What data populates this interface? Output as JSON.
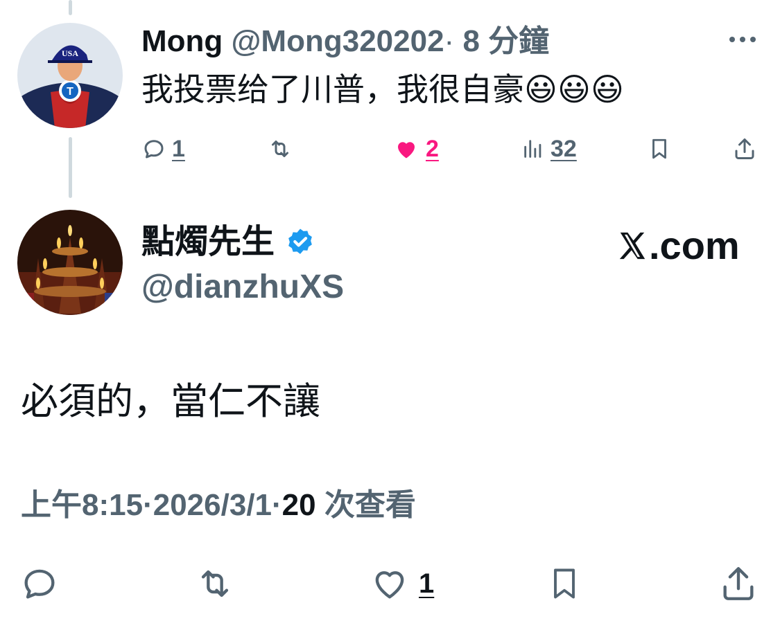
{
  "reply_tweet": {
    "display_name": "Mong",
    "handle": "@Mong320202",
    "separator": "·",
    "time_ago": "8 分鐘",
    "text": "我投票给了川普，我很自豪",
    "emojis": [
      "😃",
      "😃",
      "😃"
    ],
    "actions": {
      "reply_count": "1",
      "like_count": "2",
      "views_count": "32"
    },
    "avatar_badge_text": "USA",
    "avatar_letter": "T"
  },
  "main_tweet": {
    "display_name": "點燭先生",
    "handle": "@dianzhuXS",
    "site_label": ".com",
    "text": "必須的，當仁不讓",
    "time": "上午8:15",
    "separator": "·",
    "date": "2026/3/1",
    "views_count": "20",
    "views_label": "次查看",
    "actions": {
      "like_count": "1"
    }
  },
  "colors": {
    "text": "#0f1419",
    "muted": "#536471",
    "like": "#f91880",
    "verified": "#1d9bf0",
    "thread_line": "#cfd9de"
  }
}
